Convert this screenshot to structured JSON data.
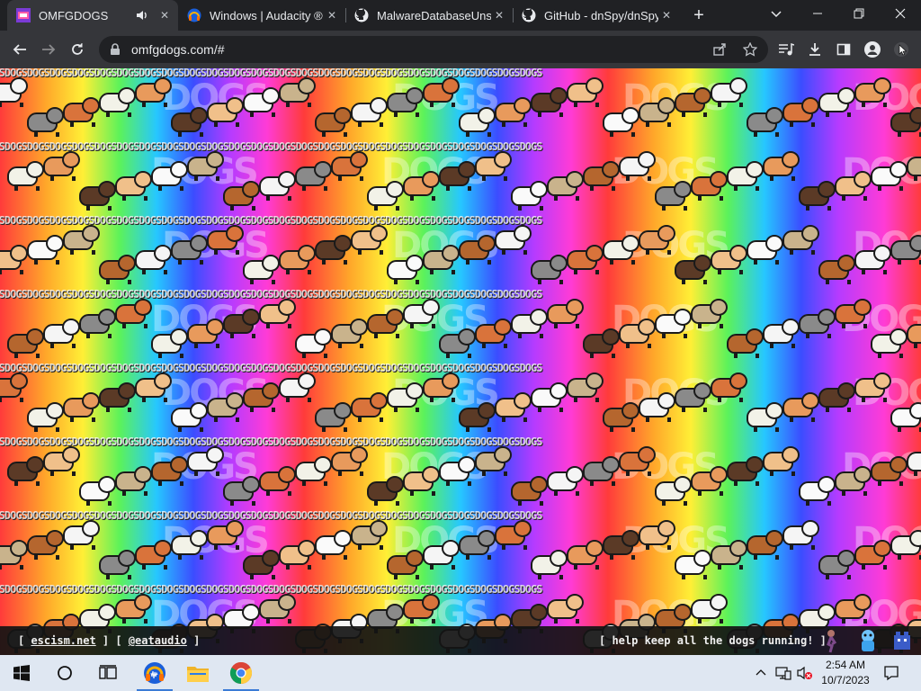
{
  "browser": {
    "tabs": [
      {
        "title": "OMFGDOGS",
        "favicon": "omfgdogs-favicon",
        "active": true,
        "audio": true
      },
      {
        "title": "Windows | Audacity ®",
        "favicon": "audacity-icon",
        "active": false
      },
      {
        "title": "MalwareDatabaseUnso",
        "favicon": "github-icon",
        "active": false
      },
      {
        "title": "GitHub - dnSpy/dnSpy",
        "favicon": "github-icon",
        "active": false
      }
    ],
    "new_tab_symbol": "+",
    "url": "omfgdogs.com/#"
  },
  "page": {
    "word_pattern": "DOGSDOGSDOGSDOGSDOGSDOGSDOGSDOGSDOGSDOGSDOGSDOGSDOGSDOGSDOGSDOGSDOGSDOGSDOGSDOGSDOGSDOGSDOGSDOGSDOGS",
    "big_word": "DOGS",
    "footer": {
      "left_open": "[ ",
      "link1": "escism.net",
      "middle": " ] [ ",
      "link2": "@eataudio",
      "left_close": " ]",
      "right_text": "[ help keep all the dogs running! ]"
    },
    "dog_colors": [
      "#f5f5f5",
      "#8a8a8a",
      "#d9733b",
      "#f2f2e8",
      "#e89a5c",
      "#5b3a26",
      "#f0c08a",
      "#fafafa",
      "#c9b38c",
      "#b5662e"
    ]
  },
  "taskbar": {
    "apps": [
      "start-button",
      "search-button",
      "task-view-button",
      "audacity-app",
      "file-explorer-app",
      "chrome-app"
    ],
    "clock_time": "2:54 AM",
    "clock_date": "10/7/2023"
  }
}
